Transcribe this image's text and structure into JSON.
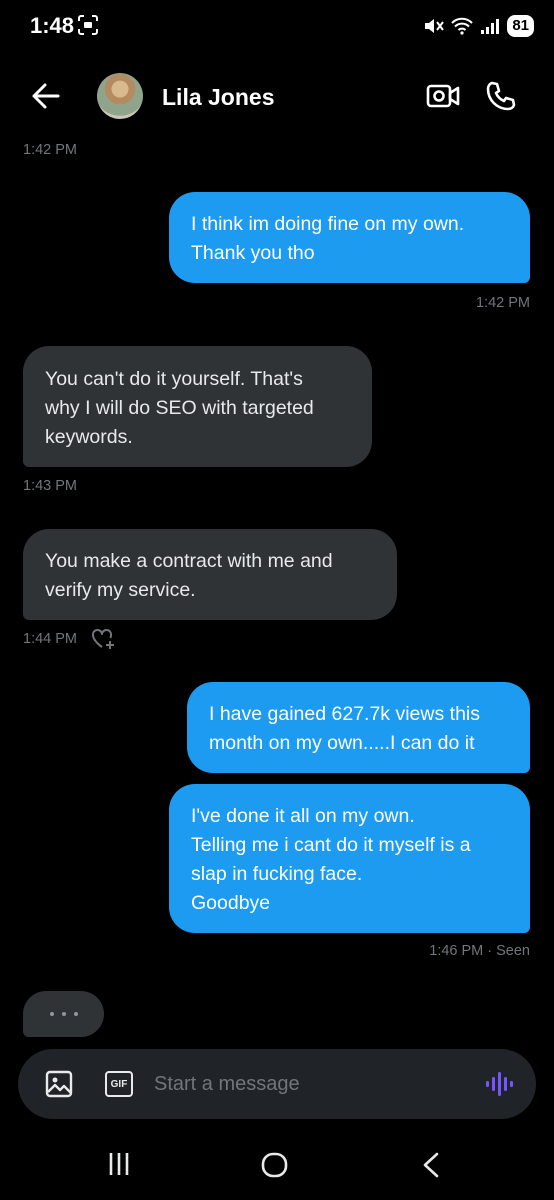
{
  "status_bar": {
    "time": "1:48",
    "battery": "81",
    "icons": [
      "screenshot-icon",
      "mute-icon",
      "wifi-icon",
      "signal-icon",
      "battery-icon"
    ]
  },
  "header": {
    "contact_name": "Lila Jones",
    "icons": [
      "back-arrow-icon",
      "avatar",
      "video-call-icon",
      "phone-call-icon"
    ]
  },
  "messages": [
    {
      "kind": "timestamp",
      "text": "1:42 PM"
    },
    {
      "kind": "outgoing",
      "lines": [
        "I think im doing fine on my own.",
        "Thank you tho"
      ]
    },
    {
      "kind": "timestamp",
      "text": "1:42 PM"
    },
    {
      "kind": "incoming",
      "lines": [
        "You can't do it yourself. That's",
        "why I will do SEO with targeted",
        "keywords."
      ]
    },
    {
      "kind": "timestamp",
      "text": "1:43 PM"
    },
    {
      "kind": "incoming",
      "lines": [
        "You make a contract with me and",
        "verify my service."
      ]
    },
    {
      "kind": "timestamp",
      "text": "1:44 PM"
    },
    {
      "kind": "outgoing",
      "lines": [
        "I have gained 627.7k views this",
        "month on my own.....I can do it"
      ]
    },
    {
      "kind": "outgoing",
      "lines": [
        "I've done it all on my own.",
        "Telling me i cant do it myself is a",
        "slap in fucking face.",
        "Goodbye"
      ]
    },
    {
      "kind": "timestamp",
      "text": "1:46 PM · Seen"
    }
  ],
  "composer": {
    "placeholder": "Start a message",
    "gif_label": "GIF",
    "accent_color": "#7856ff"
  },
  "colors": {
    "outgoing_bubble": "#1d9bf0",
    "incoming_bubble": "#2f3336",
    "background": "#000000"
  }
}
